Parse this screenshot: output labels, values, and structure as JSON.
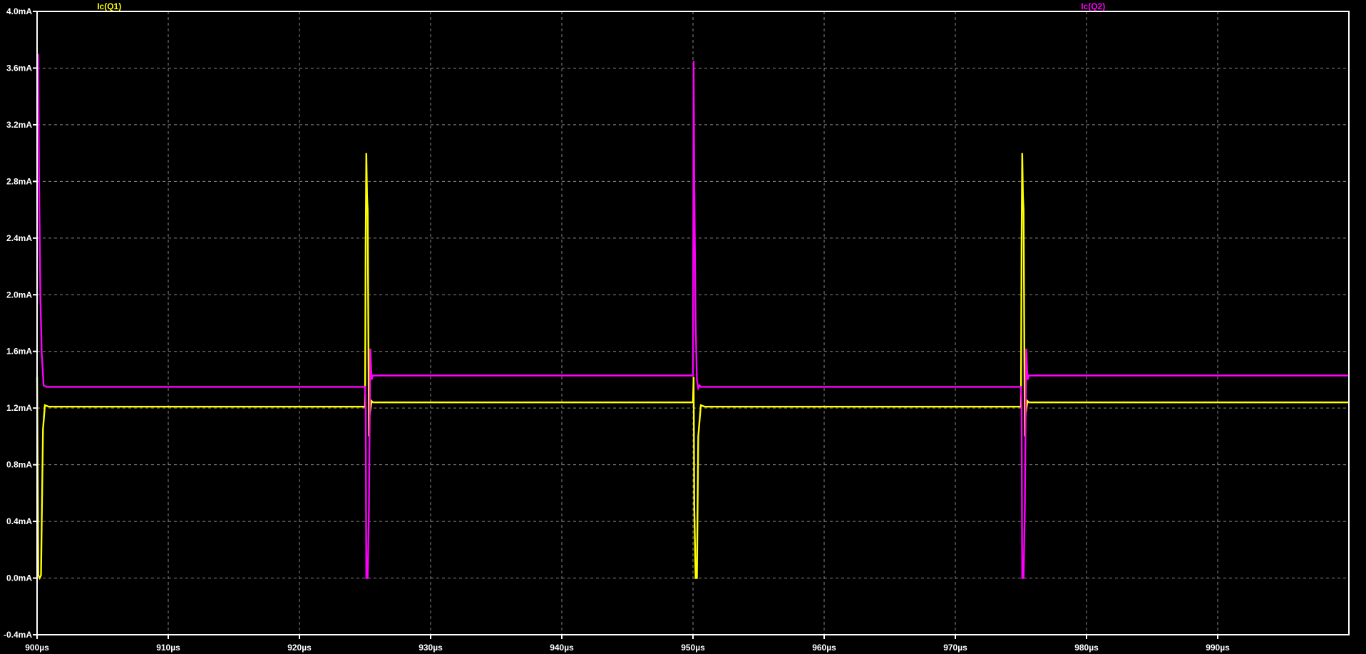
{
  "colors": {
    "background": "#000000",
    "frame": "#ffffff",
    "grid": "#8a8a8a",
    "ic_q1": "#ffff00",
    "ic_q2": "#ff00ff"
  },
  "chart_data": {
    "type": "line",
    "title": "",
    "xlabel": "",
    "ylabel": "",
    "x_unit": "µs",
    "y_unit": "mA",
    "xlim": [
      900,
      1000
    ],
    "ylim": [
      -0.4,
      4.0
    ],
    "grid": true,
    "x_tick_values": [
      900,
      910,
      920,
      930,
      940,
      950,
      960,
      970,
      980,
      990
    ],
    "x_tick_labels": [
      "900µs",
      "910µs",
      "920µs",
      "930µs",
      "940µs",
      "950µs",
      "960µs",
      "970µs",
      "980µs",
      "990µs"
    ],
    "y_tick_values": [
      -0.4,
      0.0,
      0.4,
      0.8,
      1.2,
      1.6,
      2.0,
      2.4,
      2.8,
      3.2,
      3.6,
      4.0
    ],
    "y_tick_labels": [
      "-0.4mA",
      "0.0mA",
      "0.4mA",
      "0.8mA",
      "1.2mA",
      "1.6mA",
      "2.0mA",
      "2.4mA",
      "2.8mA",
      "3.2mA",
      "3.6mA",
      "4.0mA"
    ],
    "legend_placement": "top",
    "series": [
      {
        "name": "Ic(Q1)",
        "color": "#ffff00",
        "x": [
          900.0,
          900.1,
          900.2,
          900.3,
          900.45,
          900.6,
          900.9,
          925.0,
          925.05,
          925.1,
          925.15,
          925.2,
          925.25,
          925.3,
          925.35,
          925.5,
          925.6,
          925.8,
          950.0,
          950.05,
          950.1,
          950.2,
          950.3,
          950.4,
          950.6,
          950.9,
          975.0,
          975.05,
          975.1,
          975.15,
          975.2,
          975.25,
          975.3,
          975.35,
          975.5,
          975.6,
          975.8,
          1000.0
        ],
        "y": [
          1.42,
          0.02,
          0.0,
          0.02,
          1.05,
          1.22,
          1.21,
          1.21,
          2.35,
          3.0,
          2.7,
          2.6,
          1.8,
          1.0,
          1.15,
          1.25,
          1.24,
          1.24,
          1.24,
          1.42,
          0.5,
          0.0,
          0.0,
          1.0,
          1.22,
          1.21,
          1.21,
          2.35,
          3.0,
          2.7,
          2.6,
          1.8,
          1.0,
          1.15,
          1.25,
          1.24,
          1.24,
          1.24
        ]
      },
      {
        "name": "Ic(Q2)",
        "color": "#ff00ff",
        "x": [
          900.0,
          900.08,
          900.15,
          900.25,
          900.35,
          900.5,
          900.7,
          925.0,
          925.05,
          925.1,
          925.2,
          925.3,
          925.4,
          925.5,
          925.6,
          925.8,
          950.0,
          950.05,
          950.1,
          950.2,
          950.3,
          950.4,
          950.5,
          950.6,
          950.8,
          975.0,
          975.05,
          975.1,
          975.2,
          975.3,
          975.4,
          975.5,
          975.6,
          975.8,
          1000.0
        ],
        "y": [
          3.65,
          3.7,
          2.8,
          2.0,
          1.6,
          1.36,
          1.35,
          1.35,
          1.2,
          0.0,
          0.0,
          0.5,
          1.62,
          1.4,
          1.43,
          1.43,
          1.43,
          3.65,
          2.8,
          1.8,
          1.4,
          1.34,
          1.36,
          1.35,
          1.35,
          1.35,
          1.2,
          0.0,
          0.0,
          0.5,
          1.62,
          1.4,
          1.43,
          1.43,
          1.43
        ]
      }
    ]
  }
}
